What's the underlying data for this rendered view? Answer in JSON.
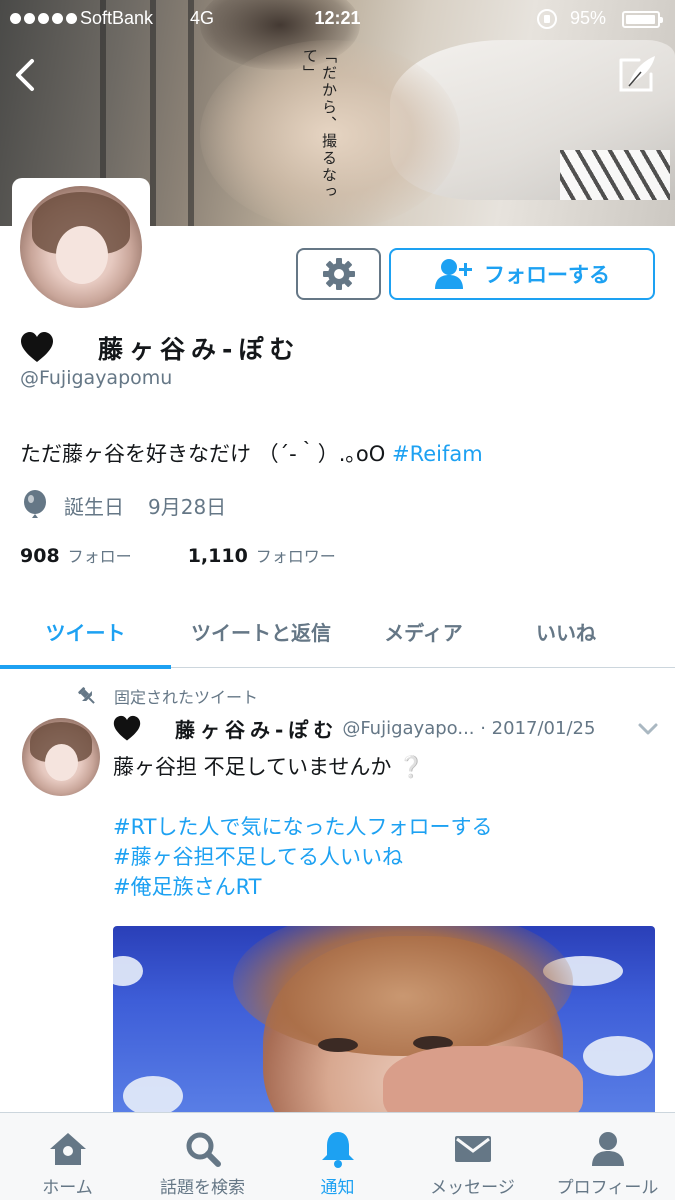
{
  "status_bar": {
    "carrier": "SoftBank",
    "network": "4G",
    "time": "12:21",
    "battery_percent": "95%",
    "battery_level": 0.95
  },
  "banner": {
    "vertical_text": "「だから、撮るなって」"
  },
  "profile": {
    "display_name": "藤ヶ谷み-ぽむ",
    "handle": "@Fujigayapomu",
    "bio_text": "ただ藤ヶ谷を好きなだけ （´-｀）.｡oO ",
    "bio_hashtag": "#Reifam",
    "birthday_label": "誕生日",
    "birthday_date": "9月28日",
    "following_count": "908",
    "following_label": "フォロー",
    "followers_count": "1,110",
    "followers_label": "フォロワー",
    "follow_button_label": "フォローする"
  },
  "tabs": [
    {
      "label": "ツイート",
      "active": true
    },
    {
      "label": "ツイートと返信",
      "active": false
    },
    {
      "label": "メディア",
      "active": false
    },
    {
      "label": "いいね",
      "active": false
    }
  ],
  "pinned_tweet": {
    "pinned_label": "固定されたツイート",
    "author_name": "藤ヶ谷み-ぽむ",
    "meta": "@Fujigayapo... · 2017/01/25",
    "text": "藤ヶ谷担 不足していませんか",
    "question_mark": "❔",
    "hashtags": [
      "#RTした人で気になった人フォローする",
      "#藤ヶ谷担不足してる人いいね",
      "#俺足族さんRT"
    ]
  },
  "bottom_nav": [
    {
      "label": "ホーム",
      "icon": "home-icon",
      "active": false
    },
    {
      "label": "話題を検索",
      "icon": "search-icon",
      "active": false
    },
    {
      "label": "通知",
      "icon": "bell-icon",
      "active": true
    },
    {
      "label": "メッセージ",
      "icon": "envelope-icon",
      "active": false
    },
    {
      "label": "プロフィール",
      "icon": "person-icon",
      "active": false
    }
  ],
  "colors": {
    "accent": "#1da1f2",
    "muted": "#657786",
    "text": "#14171a"
  }
}
